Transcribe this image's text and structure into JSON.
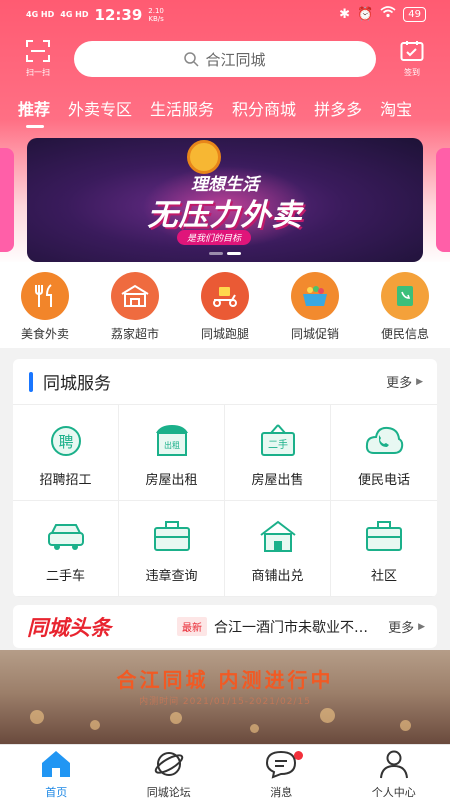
{
  "status_bar": {
    "signal_1": "4G HD",
    "signal_2": "4G HD",
    "time": "12:39",
    "net_speed": "2.10",
    "net_unit": "KB/s",
    "battery": "49"
  },
  "header": {
    "scan_label": "扫一扫",
    "search_placeholder": "合江同城",
    "signin_label": "签到"
  },
  "tabs": [
    {
      "label": "推荐",
      "active": true
    },
    {
      "label": "外卖专区"
    },
    {
      "label": "生活服务"
    },
    {
      "label": "积分商城"
    },
    {
      "label": "拼多多"
    },
    {
      "label": "淘宝"
    }
  ],
  "banner": {
    "line1": "理想生活",
    "line2": "无压力外卖",
    "tag": "是我们的目标",
    "slides": 2,
    "active_slide": 1
  },
  "quick_links": [
    {
      "label": "美食外卖",
      "icon": "fork-knife-icon",
      "color": "#f2852a"
    },
    {
      "label": "荔家超市",
      "icon": "store-icon",
      "color": "#ef6b3f"
    },
    {
      "label": "同城跑腿",
      "icon": "scooter-icon",
      "color": "#ea5a35"
    },
    {
      "label": "同城促销",
      "icon": "basket-icon",
      "color": "#f28a2e"
    },
    {
      "label": "便民信息",
      "icon": "book-icon",
      "color": "#f4a13a"
    }
  ],
  "services": {
    "title": "同城服务",
    "more": "更多",
    "items": [
      {
        "label": "招聘招工",
        "icon": "recruit-icon",
        "glyph": "聘"
      },
      {
        "label": "房屋出租",
        "icon": "rent-shop-icon",
        "glyph": "出租"
      },
      {
        "label": "房屋出售",
        "icon": "sale-sign-icon",
        "glyph": "二手"
      },
      {
        "label": "便民电话",
        "icon": "phone-cloud-icon",
        "glyph": ""
      },
      {
        "label": "二手车",
        "icon": "car-icon",
        "glyph": ""
      },
      {
        "label": "违章查询",
        "icon": "briefcase-icon",
        "glyph": ""
      },
      {
        "label": "商铺出兑",
        "icon": "house-icon",
        "glyph": ""
      },
      {
        "label": "社区",
        "icon": "community-icon",
        "glyph": ""
      }
    ],
    "accent": "#1bb08a"
  },
  "headline": {
    "logo": "同城头条",
    "badge": "最新",
    "text": "合江一酒门市未歇业不营业",
    "more": "更多"
  },
  "promo": {
    "title": "合江同城 内测进行中",
    "date": "内测时间 2021/01/15-2021/02/15"
  },
  "bottom_nav": [
    {
      "label": "首页",
      "icon": "home-icon",
      "active": true
    },
    {
      "label": "同城论坛",
      "icon": "planet-icon"
    },
    {
      "label": "消息",
      "icon": "message-icon",
      "badge": true
    },
    {
      "label": "个人中心",
      "icon": "user-icon"
    }
  ]
}
